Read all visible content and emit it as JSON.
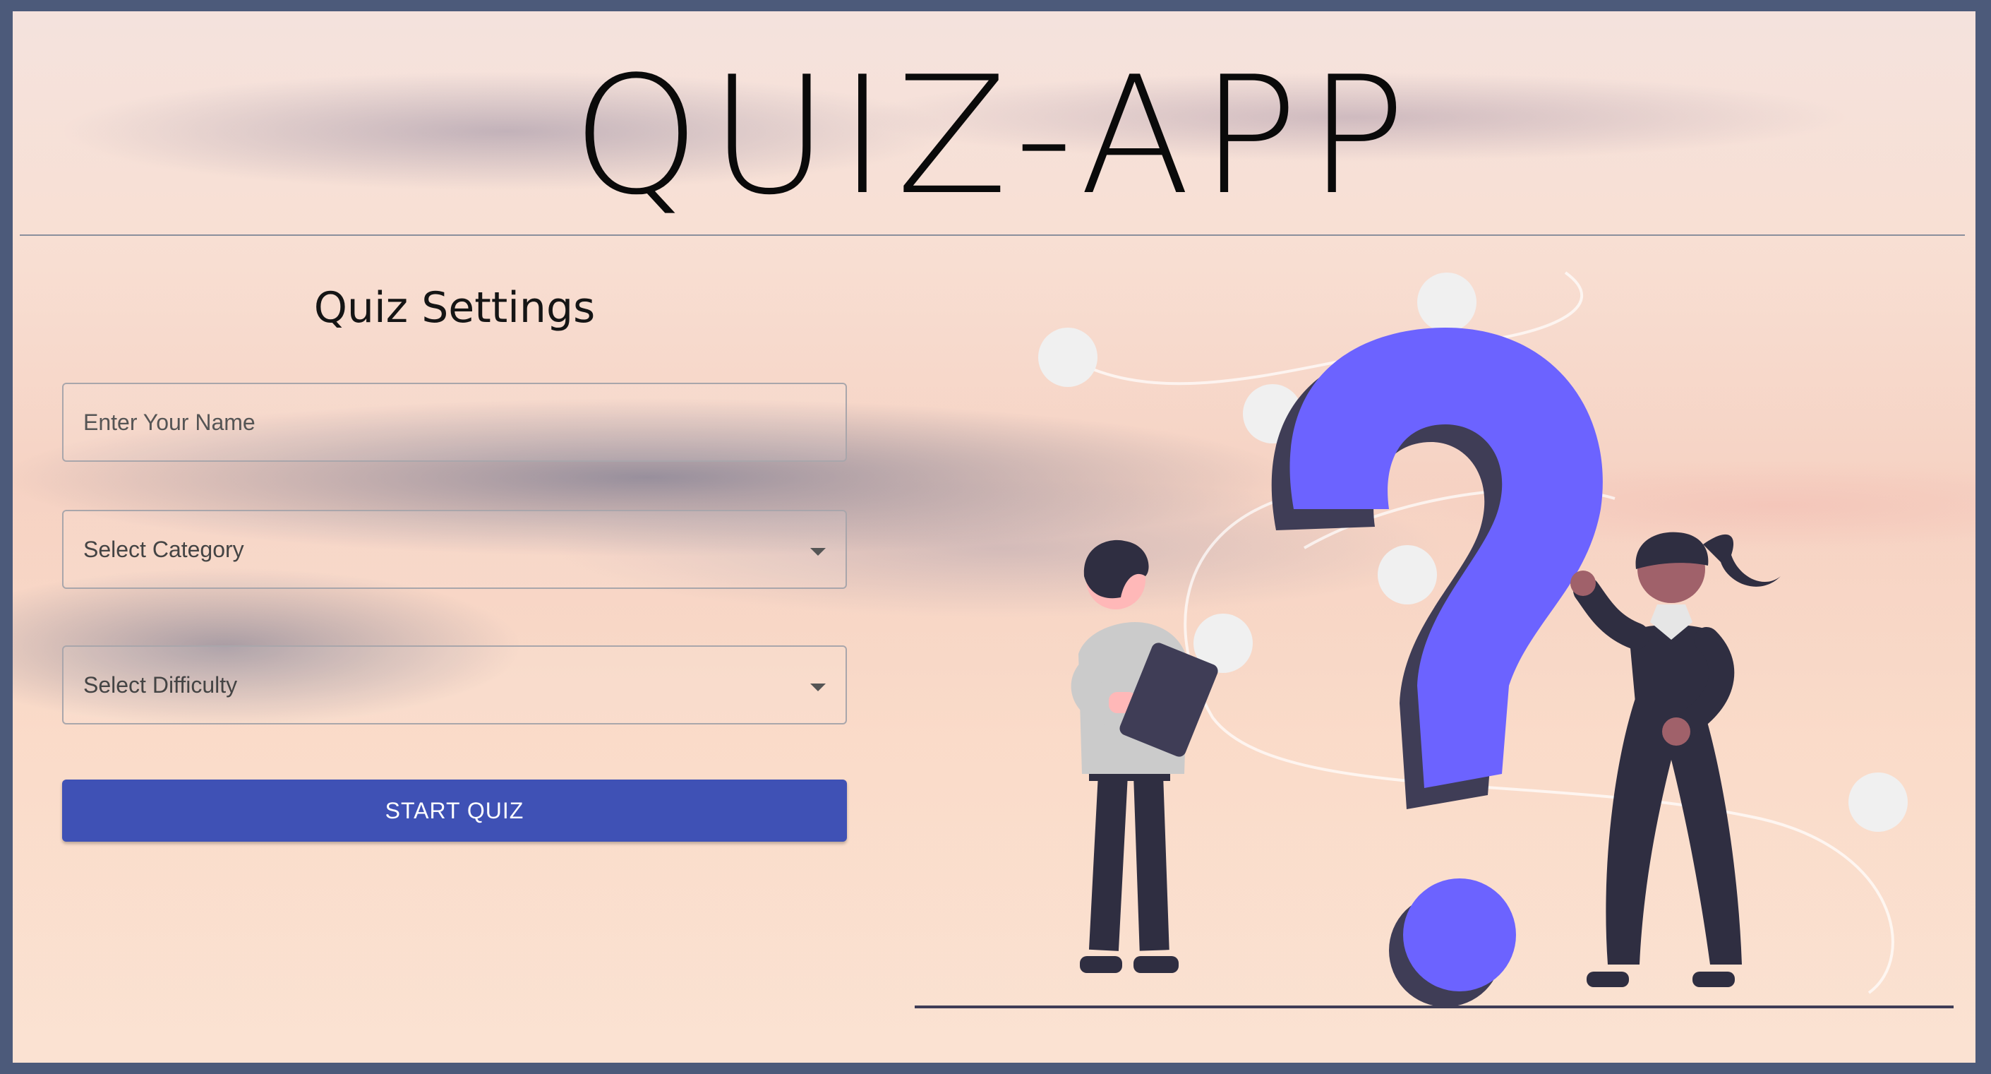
{
  "app": {
    "title": "QUIZ-APP"
  },
  "settings": {
    "heading": "Quiz Settings",
    "name_placeholder": "Enter Your Name",
    "category_label": "Select Category",
    "difficulty_label": "Select Difficulty",
    "start_button": "START QUIZ"
  },
  "colors": {
    "border": "#4c5a7a",
    "button": "#3f51b5",
    "question_mark": "#6c63ff",
    "question_shadow": "#3f3d56",
    "figure_dark": "#2f2e41"
  },
  "icons": {
    "dropdown": "chevron-down-icon",
    "illustration": "question-mark-illustration"
  }
}
